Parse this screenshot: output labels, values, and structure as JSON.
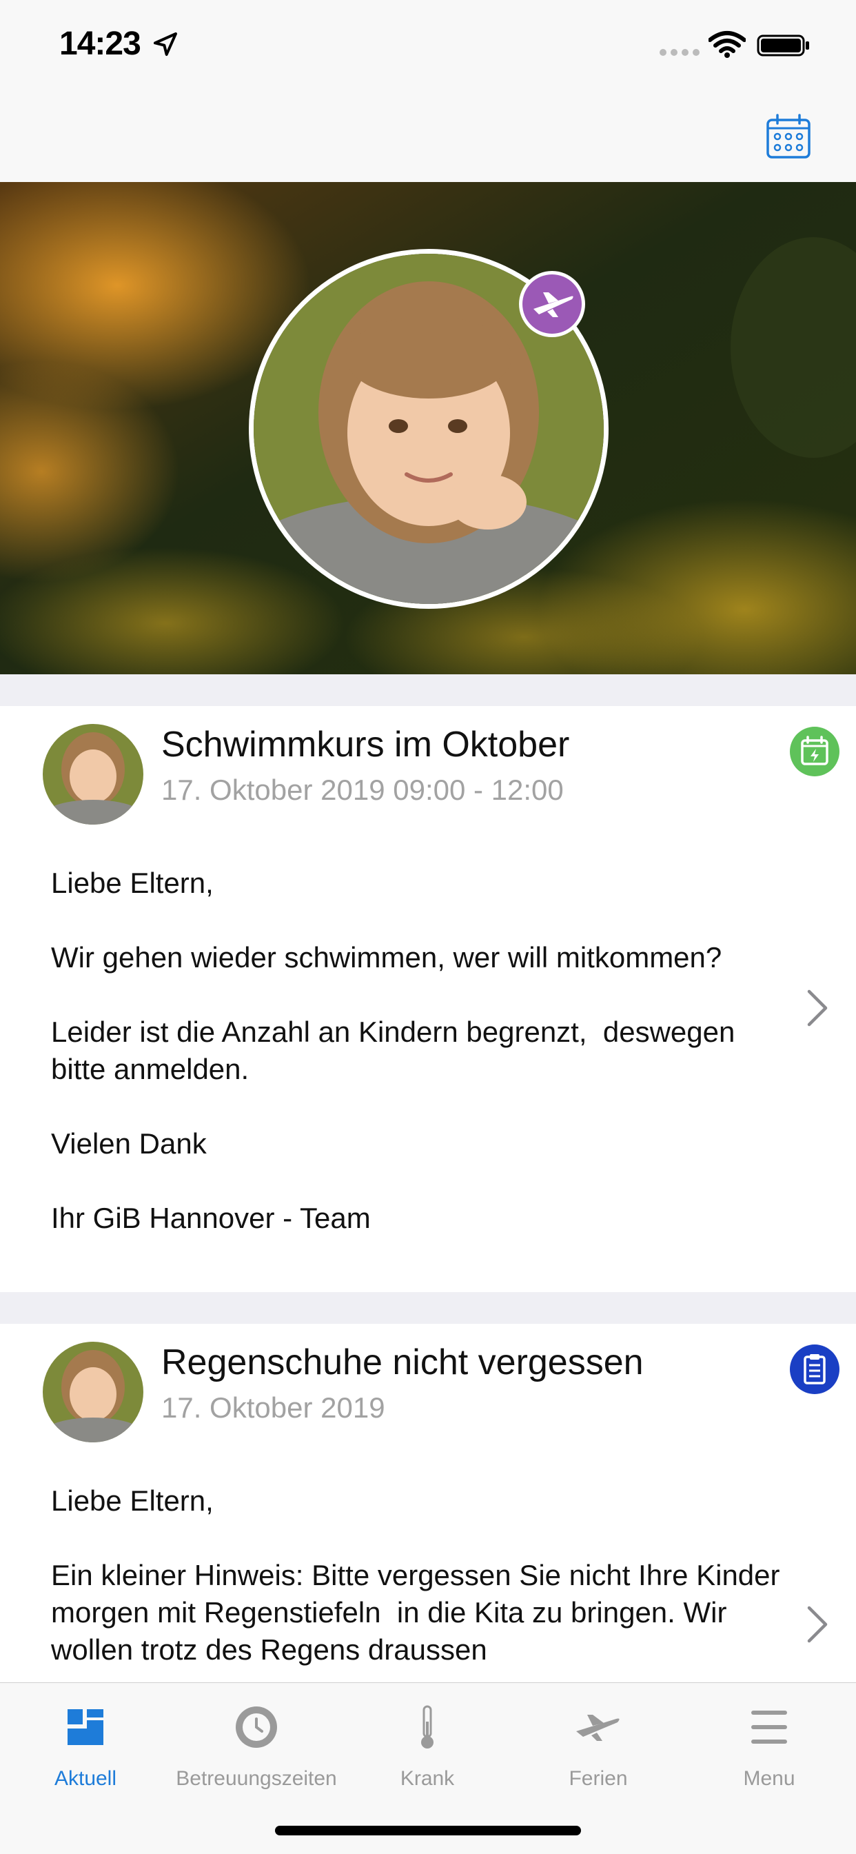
{
  "status_bar": {
    "time": "14:23"
  },
  "hero": {},
  "posts": [
    {
      "title": "Schwimmkurs im Oktober",
      "date": "17. Oktober 2019 09:00 - 12:00",
      "type_icon": "calendar-event-icon",
      "type_color": "#5fc25a",
      "body": "Liebe Eltern,\n\nWir gehen wieder schwimmen, wer will mitkommen?\n\nLeider ist die Anzahl an Kindern begrenzt,  deswegen bitte anmelden.\n\nVielen Dank\n\nIhr GiB Hannover - Team"
    },
    {
      "title": "Regenschuhe nicht vergessen",
      "date": "17. Oktober 2019",
      "type_icon": "clipboard-icon",
      "type_color": "#1a3fc4",
      "body": "Liebe Eltern,\n\nEin kleiner Hinweis: Bitte vergessen Sie nicht Ihre Kinder morgen mit Regenstiefeln  in die Kita zu bringen. Wir wollen trotz des Regens draussen"
    }
  ],
  "tabs": [
    {
      "label": "Aktuell",
      "icon": "dashboard-icon",
      "active": true
    },
    {
      "label": "Betreuungszeiten",
      "icon": "clock-icon",
      "active": false
    },
    {
      "label": "Krank",
      "icon": "thermometer-icon",
      "active": false
    },
    {
      "label": "Ferien",
      "icon": "airplane-icon",
      "active": false
    },
    {
      "label": "Menu",
      "icon": "hamburger-menu-icon",
      "active": false
    }
  ],
  "colors": {
    "accent": "#1e7cd9",
    "inactive": "#9a9a9a",
    "badge": "#9b59b6"
  }
}
